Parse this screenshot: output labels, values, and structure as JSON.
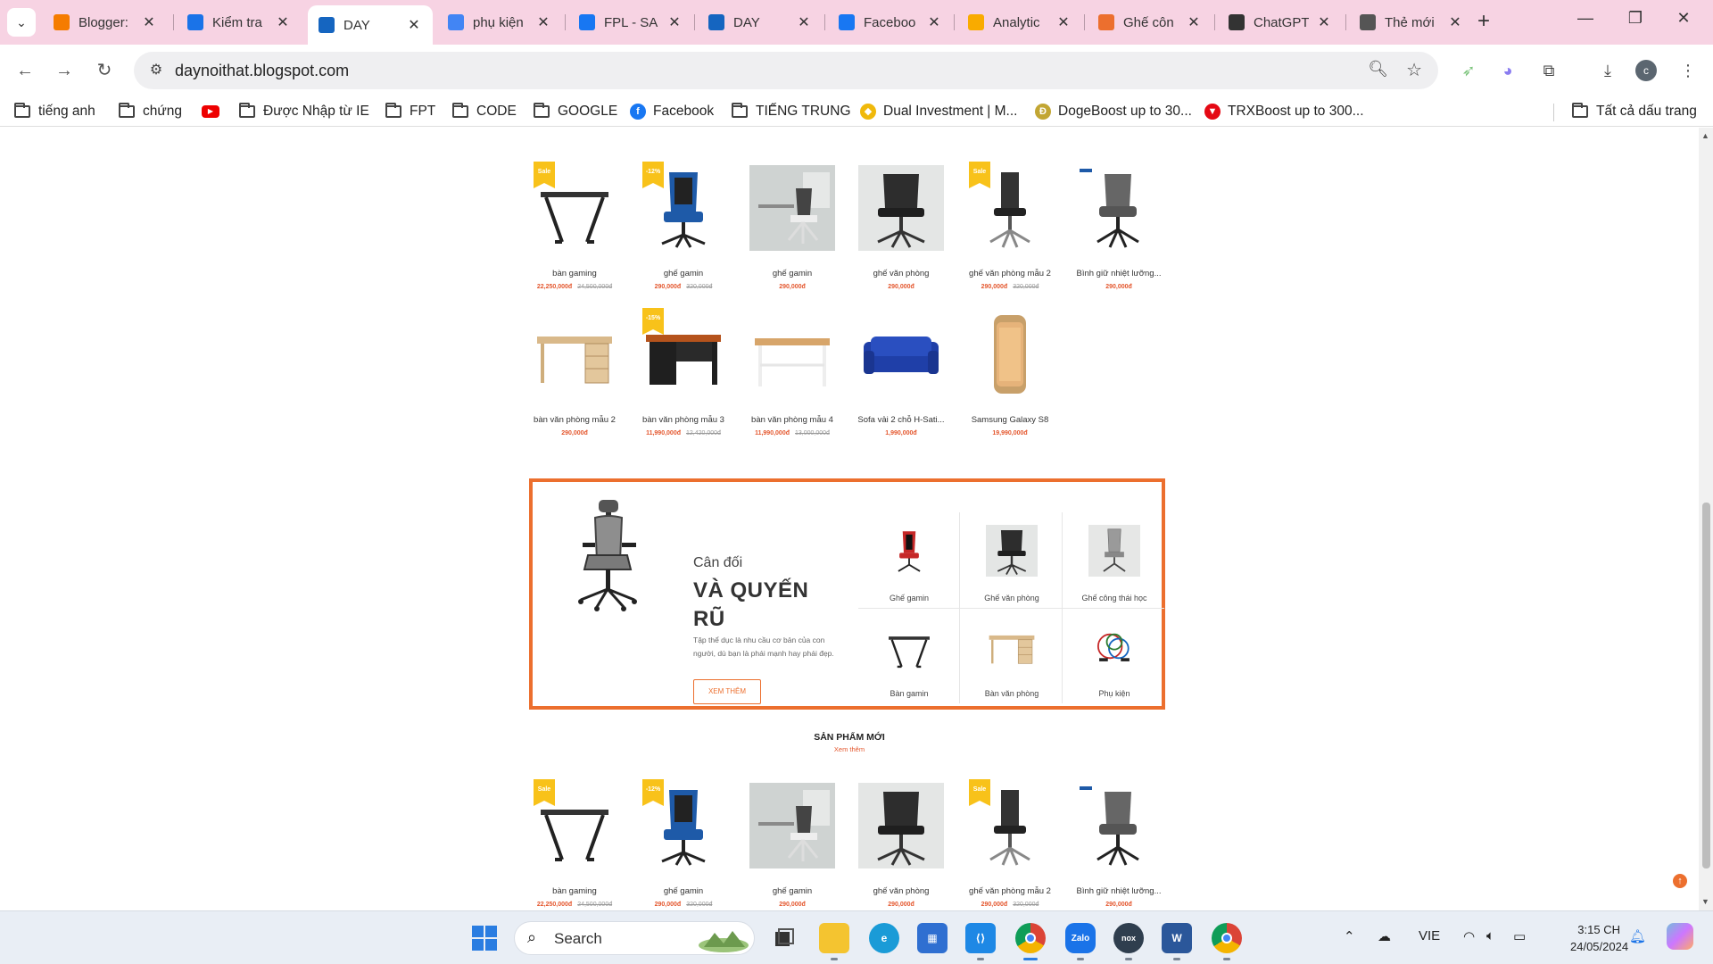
{
  "tabs": [
    {
      "title": "Blogger:",
      "favicon": "blogger-icon",
      "color": "#f57c00",
      "active": false
    },
    {
      "title": "Kiểm tra",
      "favicon": "page-icon",
      "color": "#1a73e8",
      "active": false
    },
    {
      "title": "DAY",
      "favicon": "day-logo-icon",
      "color": "#1565c0",
      "active": true
    },
    {
      "title": "phụ kiện",
      "favicon": "google-icon",
      "color": "#4285f4",
      "active": false
    },
    {
      "title": "FPL - SA",
      "favicon": "facebook-icon",
      "color": "#1877f2",
      "active": false
    },
    {
      "title": "DAY",
      "favicon": "day-logo-icon",
      "color": "#1565c0",
      "active": false
    },
    {
      "title": "Faceboo",
      "favicon": "facebook-icon",
      "color": "#1877f2",
      "active": false
    },
    {
      "title": "Analytic",
      "favicon": "analytics-icon",
      "color": "#f9ab00",
      "active": false
    },
    {
      "title": "Ghế côn",
      "favicon": "home-icon",
      "color": "#ec6f2e",
      "active": false
    },
    {
      "title": "ChatGPT",
      "favicon": "chatgpt-icon",
      "color": "#333333",
      "active": false
    },
    {
      "title": "Thẻ mới",
      "favicon": "chrome-icon",
      "color": "#555555",
      "active": false
    }
  ],
  "address": {
    "url": "daynoithat.blogspot.com"
  },
  "bookmarks": [
    {
      "label": "tiếng anh",
      "type": "folder"
    },
    {
      "label": "chứng",
      "type": "folder"
    },
    {
      "label": "",
      "type": "youtube"
    },
    {
      "label": "Được Nhập từ IE",
      "type": "folder"
    },
    {
      "label": "FPT",
      "type": "folder"
    },
    {
      "label": "CODE",
      "type": "folder"
    },
    {
      "label": "GOOGLE",
      "type": "folder"
    },
    {
      "label": "Facebook",
      "type": "facebook"
    },
    {
      "label": "TIẾNG TRUNG",
      "type": "folder"
    },
    {
      "label": "Dual Investment | M...",
      "type": "binance"
    },
    {
      "label": "DogeBoost up to 30...",
      "type": "doge"
    },
    {
      "label": "TRXBoost up to 300...",
      "type": "trx"
    },
    {
      "label": "Tất cả dấu trang",
      "type": "folder"
    }
  ],
  "products_row1": [
    {
      "name": "bàn gaming",
      "price": "22,250,000đ",
      "old": "24,500,000đ",
      "badge": "Sale",
      "kind": "desk-gaming"
    },
    {
      "name": "ghế gamin",
      "price": "290,000đ",
      "old": "320,000đ",
      "badge": "-12%",
      "kind": "chair-gaming"
    },
    {
      "name": "ghế gamin",
      "price": "290,000đ",
      "old": "",
      "badge": "",
      "kind": "chair-room"
    },
    {
      "name": "ghế văn phòng",
      "price": "290,000đ",
      "old": "",
      "badge": "",
      "kind": "chair-office"
    },
    {
      "name": "ghế văn phòng mẫu 2",
      "price": "290,000đ",
      "old": "320,000đ",
      "badge": "Sale",
      "kind": "chair-office2"
    },
    {
      "name": "Bình giữ nhiệt lưỡng...",
      "price": "290,000đ",
      "old": "",
      "badge": "",
      "kind": "chair-grey"
    }
  ],
  "products_row2": [
    {
      "name": "bàn văn phòng mẫu 2",
      "price": "290,000đ",
      "old": "",
      "badge": "",
      "kind": "desk-wood"
    },
    {
      "name": "bàn văn phòng mẫu 3",
      "price": "11,990,000đ",
      "old": "12,420,000đ",
      "badge": "-15%",
      "kind": "desk-dark"
    },
    {
      "name": "bàn văn phòng mẫu 4",
      "price": "11,990,000đ",
      "old": "13,000,000đ",
      "badge": "",
      "kind": "desk-white"
    },
    {
      "name": "Sofa vải 2 chỗ H-Sati...",
      "price": "1,990,000đ",
      "old": "",
      "badge": "",
      "kind": "sofa"
    },
    {
      "name": "Samsung Galaxy S8",
      "price": "19,990,000đ",
      "old": "",
      "badge": "",
      "kind": "phone"
    }
  ],
  "banner": {
    "small_title": "Cân đối",
    "big_title": "VÀ QUYẾN RŨ",
    "description": "Tập thể dục là nhu cầu cơ bản của con người, dù bạn là phái mạnh hay phái đẹp.",
    "cta": "XEM THÊM",
    "categories": [
      {
        "label": "Ghế gamin",
        "kind": "chair-red"
      },
      {
        "label": "Ghế văn phòng",
        "kind": "chair-office"
      },
      {
        "label": "Ghế công thái học",
        "kind": "chair-ergo"
      },
      {
        "label": "Bàn gamin",
        "kind": "desk-gaming"
      },
      {
        "label": "Bàn văn phòng",
        "kind": "desk-wood"
      },
      {
        "label": "Phụ kiện",
        "kind": "accessories"
      }
    ]
  },
  "new_section": {
    "title": "SẢN PHẨM MỚI",
    "more": "Xem thêm"
  },
  "products_row3": [
    {
      "name": "bàn gaming",
      "price": "22,250,000đ",
      "old": "24,500,000đ",
      "badge": "Sale",
      "kind": "desk-gaming"
    },
    {
      "name": "ghế gamin",
      "price": "290,000đ",
      "old": "320,000đ",
      "badge": "-12%",
      "kind": "chair-gaming"
    },
    {
      "name": "ghế gamin",
      "price": "290,000đ",
      "old": "",
      "badge": "",
      "kind": "chair-room"
    },
    {
      "name": "ghế văn phòng",
      "price": "290,000đ",
      "old": "",
      "badge": "",
      "kind": "chair-office"
    },
    {
      "name": "ghế văn phòng mẫu 2",
      "price": "290,000đ",
      "old": "320,000đ",
      "badge": "Sale",
      "kind": "chair-office2"
    },
    {
      "name": "Bình giữ nhiệt lưỡng...",
      "price": "290,000đ",
      "old": "",
      "badge": "",
      "kind": "chair-grey"
    }
  ],
  "taskbar": {
    "search_label": "Search",
    "language": "VIE",
    "time": "3:15 CH",
    "date": "24/05/2024",
    "apps": [
      "windows-start-icon",
      "task-view-icon",
      "file-explorer-icon",
      "edge-icon",
      "store-icon",
      "vscode-icon",
      "chrome-icon",
      "zalo-icon",
      "nox-icon",
      "word-icon",
      "chrome-profile-icon"
    ]
  },
  "colors": {
    "accent": "#ec6f2e",
    "price": "#e4572e",
    "tabstrip": "#f7d3e3",
    "sale_badge": "#f8c21a"
  }
}
